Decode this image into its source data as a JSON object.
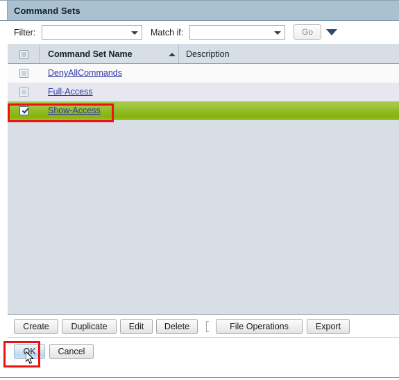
{
  "window": {
    "title": "Command Sets"
  },
  "filter_bar": {
    "filter_label": "Filter:",
    "filter_value": "",
    "filter_placeholder": "",
    "match_label": "Match if:",
    "match_value": "",
    "match_placeholder": "",
    "go_label": "Go",
    "expand_icon": "caret-down-icon",
    "filter_dropdown_icon": "chevron-down-icon",
    "match_dropdown_icon": "chevron-down-icon"
  },
  "table": {
    "columns": [
      {
        "key": "checkbox",
        "label": ""
      },
      {
        "key": "name",
        "label": "Command Set Name",
        "sorted": "asc",
        "sort_icon": "sort-ascending-icon"
      },
      {
        "key": "description",
        "label": "Description"
      }
    ],
    "header_select_all_checked": false,
    "rows": [
      {
        "checked": false,
        "name": "DenyAllCommands",
        "description": ""
      },
      {
        "checked": false,
        "name": "Full-Access",
        "description": ""
      },
      {
        "checked": true,
        "name": "Show-Access",
        "description": ""
      }
    ]
  },
  "toolbar": {
    "create_label": "Create",
    "duplicate_label": "Duplicate",
    "edit_label": "Edit",
    "delete_label": "Delete",
    "file_operations_label": "File Operations",
    "export_label": "Export"
  },
  "dialog_buttons": {
    "ok_label": "OK",
    "cancel_label": "Cancel"
  },
  "annotations": {
    "selected_row_highlight": "#ef1111",
    "ok_button_highlight": "#ef1111"
  },
  "colors": {
    "titlebar": "#a9c1d1",
    "selected_row_green": "#8fba22",
    "table_background": "#d7dee6",
    "link": "#2f36a8",
    "annotation_red": "#ef1111"
  }
}
